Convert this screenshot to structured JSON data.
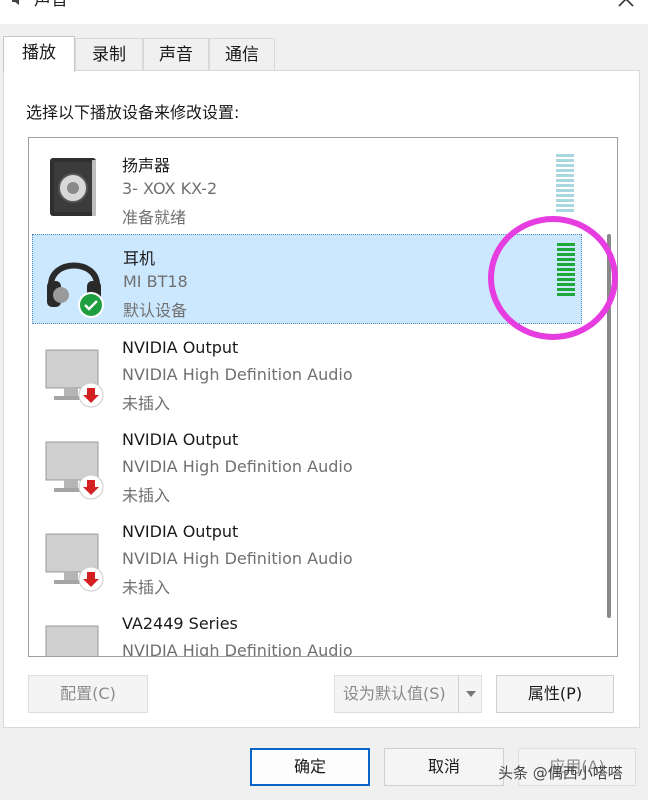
{
  "window": {
    "title": "声音",
    "close_icon": "close-icon"
  },
  "tabs": [
    {
      "label": "播放",
      "active": true
    },
    {
      "label": "录制",
      "active": false
    },
    {
      "label": "声音",
      "active": false
    },
    {
      "label": "通信",
      "active": false
    }
  ],
  "instruction": "选择以下播放设备来修改设置:",
  "devices": [
    {
      "name": "扬声器",
      "subtitle": "3- XOX KX-2",
      "status": "准备就绪",
      "icon": "speaker-icon",
      "selected": false,
      "meter": "idle"
    },
    {
      "name": "耳机",
      "subtitle": "MI BT18",
      "status": "默认设备",
      "icon": "headphones-icon",
      "selected": true,
      "meter": "active",
      "badge": "default-check-icon"
    },
    {
      "name": "NVIDIA Output",
      "subtitle": "NVIDIA High Definition Audio",
      "status": "未插入",
      "icon": "monitor-icon",
      "selected": false,
      "badge": "unplugged-icon"
    },
    {
      "name": "NVIDIA Output",
      "subtitle": "NVIDIA High Definition Audio",
      "status": "未插入",
      "icon": "monitor-icon",
      "selected": false,
      "badge": "unplugged-icon"
    },
    {
      "name": "NVIDIA Output",
      "subtitle": "NVIDIA High Definition Audio",
      "status": "未插入",
      "icon": "monitor-icon",
      "selected": false,
      "badge": "unplugged-icon"
    },
    {
      "name": "VA2449 Series",
      "subtitle": "NVIDIA High Definition Audio",
      "status": "",
      "icon": "monitor-icon",
      "selected": false
    }
  ],
  "buttons": {
    "configure": "配置(C)",
    "set_default": "设为默认值(S)",
    "properties": "属性(P)",
    "ok": "确定",
    "cancel": "取消",
    "apply": "应用(A)"
  },
  "watermark": "头条 @偶西小嗒嗒",
  "colors": {
    "selection": "#cce8ff",
    "meter_active": "#1fa83a",
    "meter_idle": "#a9d7df",
    "highlight_ring": "#e63de0",
    "default_badge": "#1e9e3e",
    "unplugged_badge": "#d42020"
  }
}
